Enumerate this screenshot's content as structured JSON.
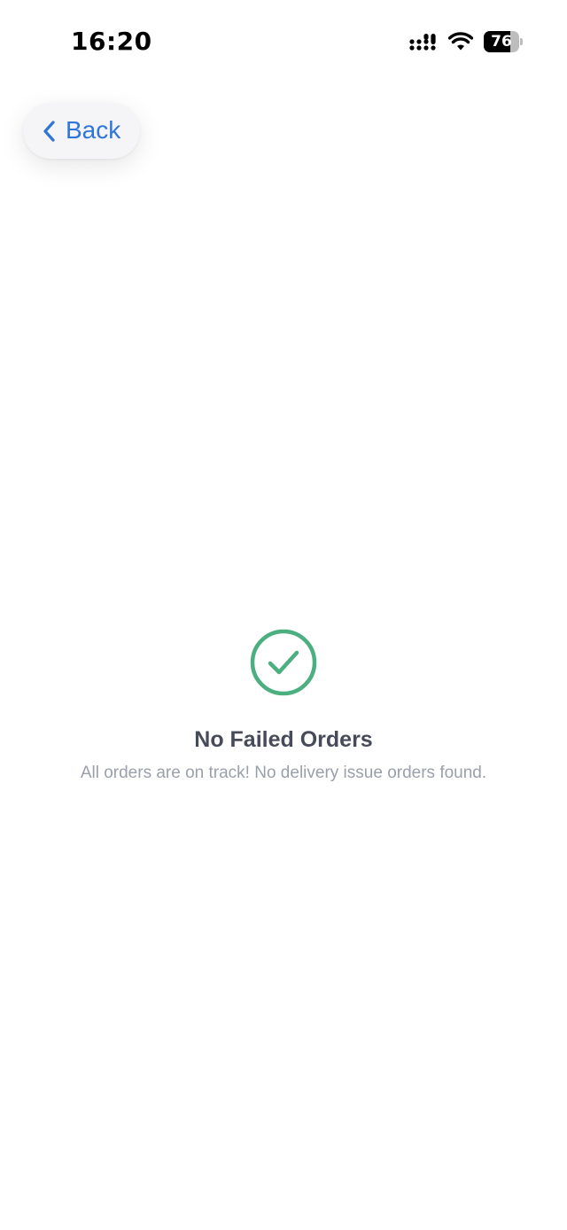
{
  "status_bar": {
    "time": "16:20",
    "battery_level": "76",
    "battery_percent": 76,
    "signal_icon": "cellular-signal-icon",
    "wifi_icon": "wifi-icon"
  },
  "nav": {
    "back_label": "Back",
    "back_icon": "chevron-left-icon"
  },
  "empty_state": {
    "icon": "check-circle-icon",
    "title": "No Failed Orders",
    "subtitle": "All orders are on track! No delivery issue orders found."
  },
  "colors": {
    "accent": "#2f76d9",
    "success": "#4caf7f",
    "title": "#474b59",
    "subtitle": "#9aa0aa"
  }
}
